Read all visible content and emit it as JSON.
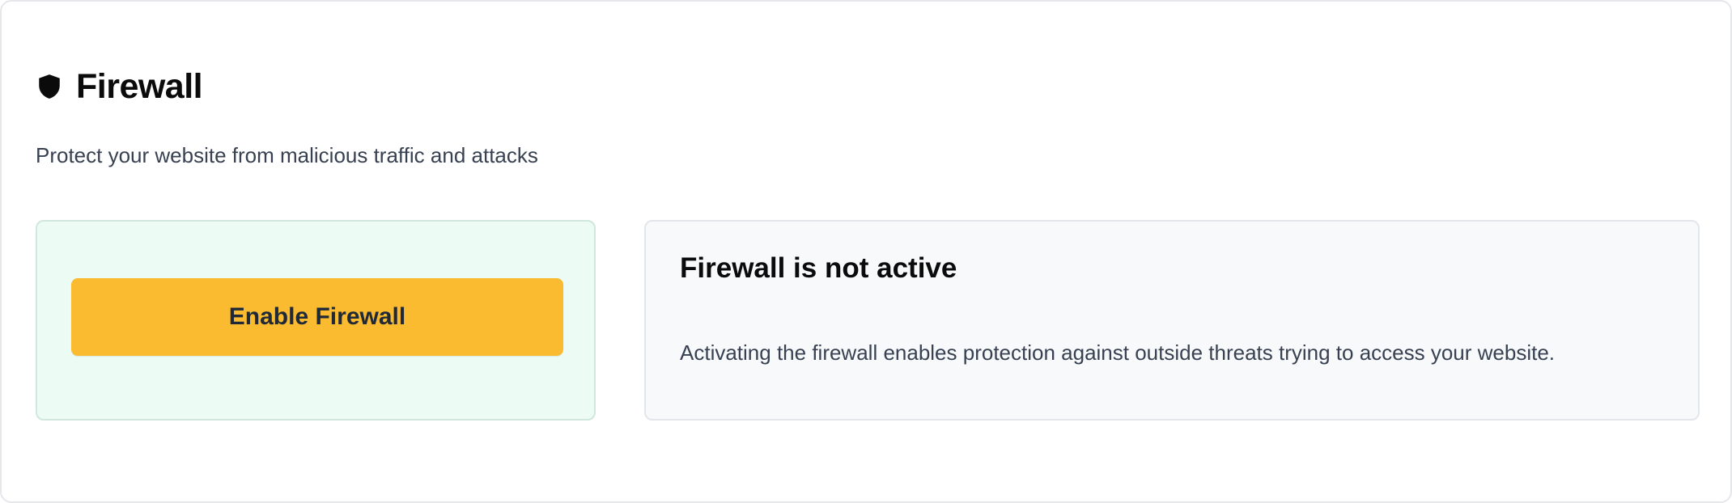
{
  "header": {
    "icon": "shield-icon",
    "title": "Firewall",
    "subtitle": "Protect your website from malicious traffic and attacks"
  },
  "action_panel": {
    "button_label": "Enable Firewall",
    "button_color": "#fbbb30",
    "panel_color": "#ecfbf3"
  },
  "status_panel": {
    "title": "Firewall is not active",
    "description": "Activating the firewall enables protection against outside threats trying to access your website.",
    "panel_color": "#f8f9fb"
  }
}
